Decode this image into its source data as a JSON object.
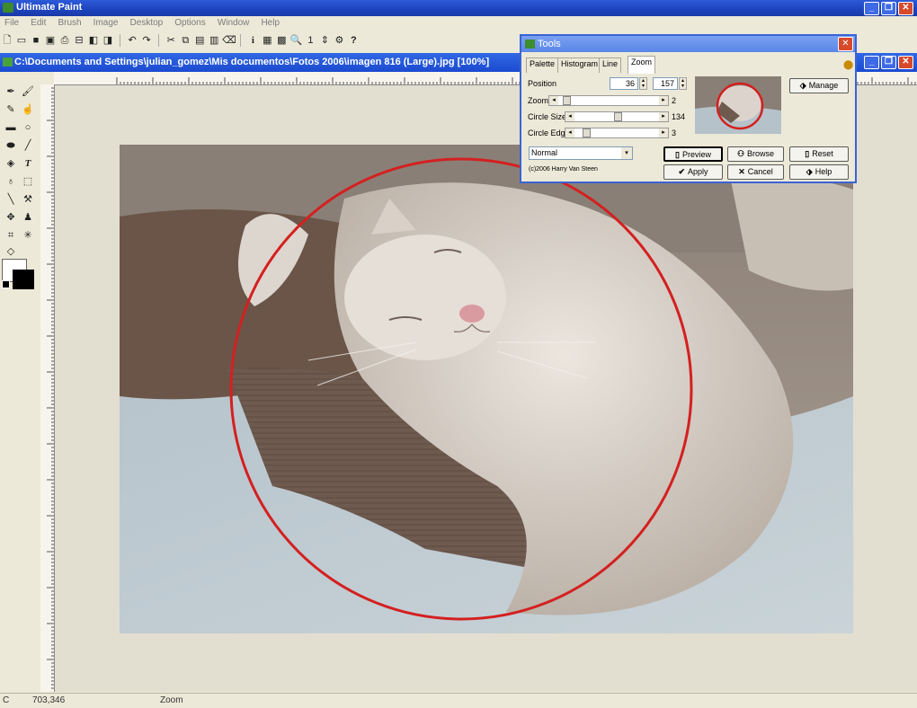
{
  "app": {
    "title": "Ultimate Paint"
  },
  "menu": [
    "File",
    "Edit",
    "Brush",
    "Image",
    "Desktop",
    "Options",
    "Window",
    "Help"
  ],
  "toolbar": {
    "page_number": "1"
  },
  "document": {
    "title": "C:\\Documents and Settings\\julian_gomez\\Mis documentos\\Fotos 2006\\imagen 816 (Large).jpg [100%]"
  },
  "status": {
    "left": "C",
    "coords": "703,346",
    "mode": "Zoom"
  },
  "dialog": {
    "title": "Tools",
    "tabs": [
      "Palette",
      "Histogram",
      "Line",
      "Zoom"
    ],
    "active_tab": "Zoom",
    "position_label": "Position",
    "position_x": "36",
    "position_y": "157",
    "zoom_label": "Zoom",
    "zoom_value": "2",
    "circle_size_label": "Circle Size",
    "circle_size_value": "134",
    "circle_edge_label": "Circle Edge",
    "circle_edge_value": "3",
    "blend_mode": "Normal",
    "copyright": "(c)2006 Harry Van Steen",
    "manage_label": "Manage",
    "preview_label": "Preview",
    "browse_label": "Browse",
    "reset_label": "Reset",
    "apply_label": "Apply",
    "cancel_label": "Cancel",
    "help_label": "Help",
    "sliders": {
      "zoom": 0.05,
      "circle_size": 0.52,
      "circle_edge": 0.1
    }
  },
  "colors": {
    "accent": "#2355d6",
    "circle": "#d42020"
  },
  "icons": [
    "pen-icon",
    "brush-icon",
    "fill-icon",
    "text-icon",
    "eraser-icon",
    "move-icon",
    "zoom-icon",
    "help-icon"
  ]
}
